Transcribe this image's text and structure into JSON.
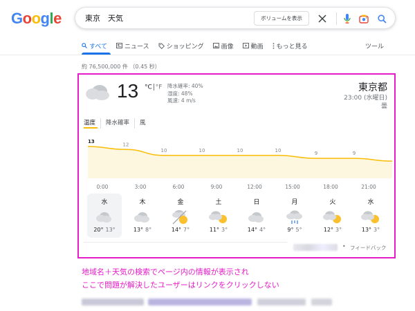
{
  "logo": {
    "letters": [
      "G",
      "o",
      "o",
      "g",
      "l",
      "e"
    ],
    "colors": [
      "#4285f4",
      "#ea4335",
      "#fbbc05",
      "#4285f4",
      "#34a853",
      "#ea4335"
    ]
  },
  "search": {
    "query": "東京　天気",
    "volume_button": "ボリュームを表示"
  },
  "tabs": [
    {
      "icon": "search-icon",
      "label": "すべて"
    },
    {
      "icon": "news-icon",
      "label": "ニュース"
    },
    {
      "icon": "tag-icon",
      "label": "ショッピング"
    },
    {
      "icon": "image-icon",
      "label": "画像"
    },
    {
      "icon": "video-icon",
      "label": "動画"
    },
    {
      "icon": "more-icon",
      "label": "もっと見る"
    }
  ],
  "tools_label": "ツール",
  "result_stats": "約 76,500,000 件 （0.45 秒）",
  "weather": {
    "temperature": "13",
    "unit_c": "°C",
    "unit_f": "°F",
    "precip": "降水確率: 40%",
    "humidity": "湿度: 48%",
    "wind": "風速: 4 m/s",
    "location": "東京都",
    "time": "23:00 (水曜日)",
    "condition": "曇",
    "tabs": [
      "温度",
      "降水確率",
      "風"
    ],
    "hourly_temps": [
      13,
      12,
      10,
      10,
      10,
      10,
      9,
      9
    ],
    "hourly_labels": [
      "0:00",
      "3:00",
      "6:00",
      "9:00",
      "12:00",
      "15:00",
      "18:00",
      "21:00"
    ],
    "days": [
      {
        "name": "水",
        "icon": "cloudy-icon",
        "hi": "20°",
        "lo": "13°"
      },
      {
        "name": "木",
        "icon": "cloudy-icon",
        "hi": "13°",
        "lo": "8°"
      },
      {
        "name": "金",
        "icon": "sun-cloud-icon",
        "hi": "14°",
        "lo": "7°"
      },
      {
        "name": "土",
        "icon": "cloud-sun-icon",
        "hi": "11°",
        "lo": "3°"
      },
      {
        "name": "日",
        "icon": "cloudy-icon",
        "hi": "14°",
        "lo": "4°"
      },
      {
        "name": "月",
        "icon": "rain-icon",
        "hi": "9°",
        "lo": "5°"
      },
      {
        "name": "火",
        "icon": "cloud-sun-icon",
        "hi": "12°",
        "lo": "3°"
      },
      {
        "name": "水",
        "icon": "cloud-sun-icon",
        "hi": "13°",
        "lo": "3°"
      }
    ],
    "feedback": "フィードバック"
  },
  "annotation": {
    "line1": "地域名＋天気の検索でページ内の情報が表示され",
    "line2": "ここで問題が解決したユーザーはリンクをクリックしない"
  },
  "colors": {
    "accent": "#1a73e8",
    "highlight": "#e61cc8",
    "chart_line": "#fbbc04",
    "chart_fill": "#fef7e0"
  }
}
